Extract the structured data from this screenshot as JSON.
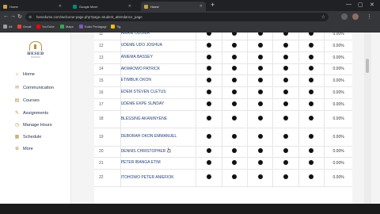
{
  "browser": {
    "tabs": [
      {
        "label": "Home",
        "favicon_color": "#c9a04a"
      },
      {
        "label": "Google Meet",
        "favicon_color": "#00897b"
      },
      {
        "label": "Home",
        "favicon_color": "#c9a04a"
      }
    ],
    "new_tab": "+",
    "url": "hesedums.com/welcome-page.php?page=student_attendance_page",
    "bookmarks": [
      {
        "label": "All",
        "color": "#9aa0a6"
      },
      {
        "label": "Gmail",
        "color": "#ea4335"
      },
      {
        "label": "YouTube",
        "color": "#ff0000"
      },
      {
        "label": "Maps",
        "color": "#34a853"
      },
      {
        "label": "Kobo Pedagogi",
        "color": "#7e57c2"
      },
      {
        "label": "Tig",
        "color": "#fbbc04"
      }
    ],
    "icons": [
      "back-icon",
      "forward-icon",
      "reload-icon",
      "lock-icon",
      "star-icon",
      "profile-icon",
      "menu-icon"
    ],
    "controls": {
      "minimize": "—",
      "maximize": "▢",
      "close": "✕"
    }
  },
  "sidebar": {
    "logo_text": "HESED",
    "logo_subtext": "SCHOOLS",
    "items": [
      {
        "label": "Home",
        "icon": "home-icon",
        "glyph": "⌂"
      },
      {
        "label": "Communication",
        "icon": "chat-icon",
        "glyph": "✉"
      },
      {
        "label": "Courses",
        "icon": "book-icon",
        "glyph": "▤"
      },
      {
        "label": "Assignments",
        "icon": "clipboard-icon",
        "glyph": "✎"
      },
      {
        "label": "Manage Hours",
        "icon": "clock-icon",
        "glyph": "◷"
      },
      {
        "label": "Schedule",
        "icon": "calendar-icon",
        "glyph": "▦"
      },
      {
        "label": "More",
        "icon": "more-icon",
        "glyph": "⊕"
      }
    ]
  },
  "attendance": {
    "rows": [
      {
        "num": "11",
        "name": "AMANI ODOMA",
        "percent": "0.00%"
      },
      {
        "num": "12",
        "name": "UDEME UDO JOSHUA",
        "percent": "0.00%"
      },
      {
        "num": "13",
        "name": "ANIEMA BASSEY",
        "percent": "0.00%"
      },
      {
        "num": "14",
        "name": "AKWAOWO PATRICK",
        "percent": "0.00%"
      },
      {
        "num": "15",
        "name": "ETIMBUK OKON",
        "percent": "0.00%"
      },
      {
        "num": "16",
        "name": "EDEM STEVEN CLETUS",
        "percent": "0.00%"
      },
      {
        "num": "17",
        "name": "UDEME EKPE SUNDAY",
        "percent": "0.00%"
      },
      {
        "num": "18",
        "name": "BLESSING AKANINYENE",
        "percent": "0.00%"
      },
      {
        "num": "19",
        "name": "DEBORAH OKON EMMANUEL",
        "percent": "0.00%"
      },
      {
        "num": "20",
        "name": "DENNIS CHRISTOPHER",
        "percent": "0.00%"
      },
      {
        "num": "21",
        "name": "PETER IBANGA ETIM",
        "percent": "0.00%"
      },
      {
        "num": "22",
        "name": "ITOHOWO PETER ANIEFIOK",
        "percent": "0.00%"
      }
    ],
    "marks_per_row": 5
  },
  "colors": {
    "accent": "#b8923f",
    "navy": "#1c2c5b",
    "link": "#243e7a"
  }
}
